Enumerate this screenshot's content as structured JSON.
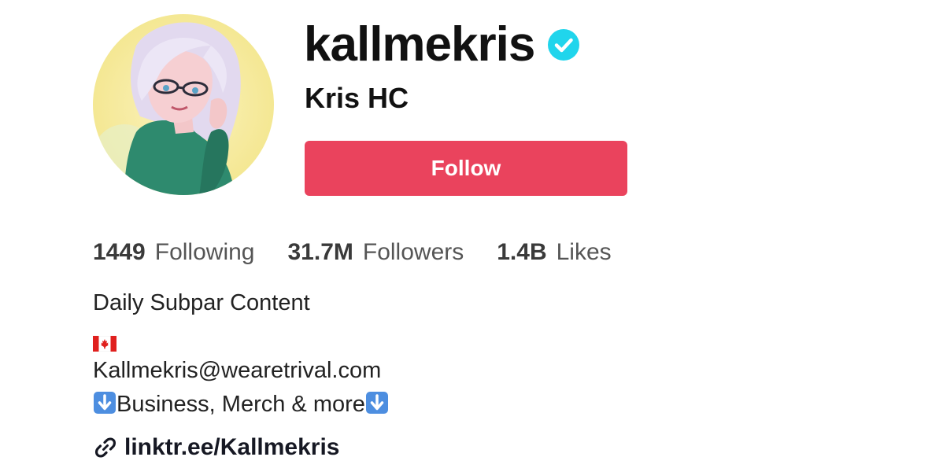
{
  "profile": {
    "username": "kallmekris",
    "nickname": "Kris HC",
    "verified_icon": "verified-badge-icon",
    "avatar_icon": "cartoon-avatar-image"
  },
  "actions": {
    "follow_label": "Follow"
  },
  "stats": {
    "following_count": "1449",
    "following_label": "Following",
    "followers_count": "31.7M",
    "followers_label": "Followers",
    "likes_count": "1.4B",
    "likes_label": "Likes"
  },
  "bio": {
    "line1": "Daily Subpar Content",
    "flag_icon": "canada-flag-icon",
    "email": "Kallmekris@wearetrival.com",
    "line4_text": "Business, Merch & more",
    "arrow_icon": "down-arrow-emoji-icon"
  },
  "link": {
    "icon": "link-icon",
    "text": "linktr.ee/Kallmekris"
  },
  "colors": {
    "follow_button": "#ea435d",
    "verified": "#20d5ec",
    "text": "#161823"
  }
}
